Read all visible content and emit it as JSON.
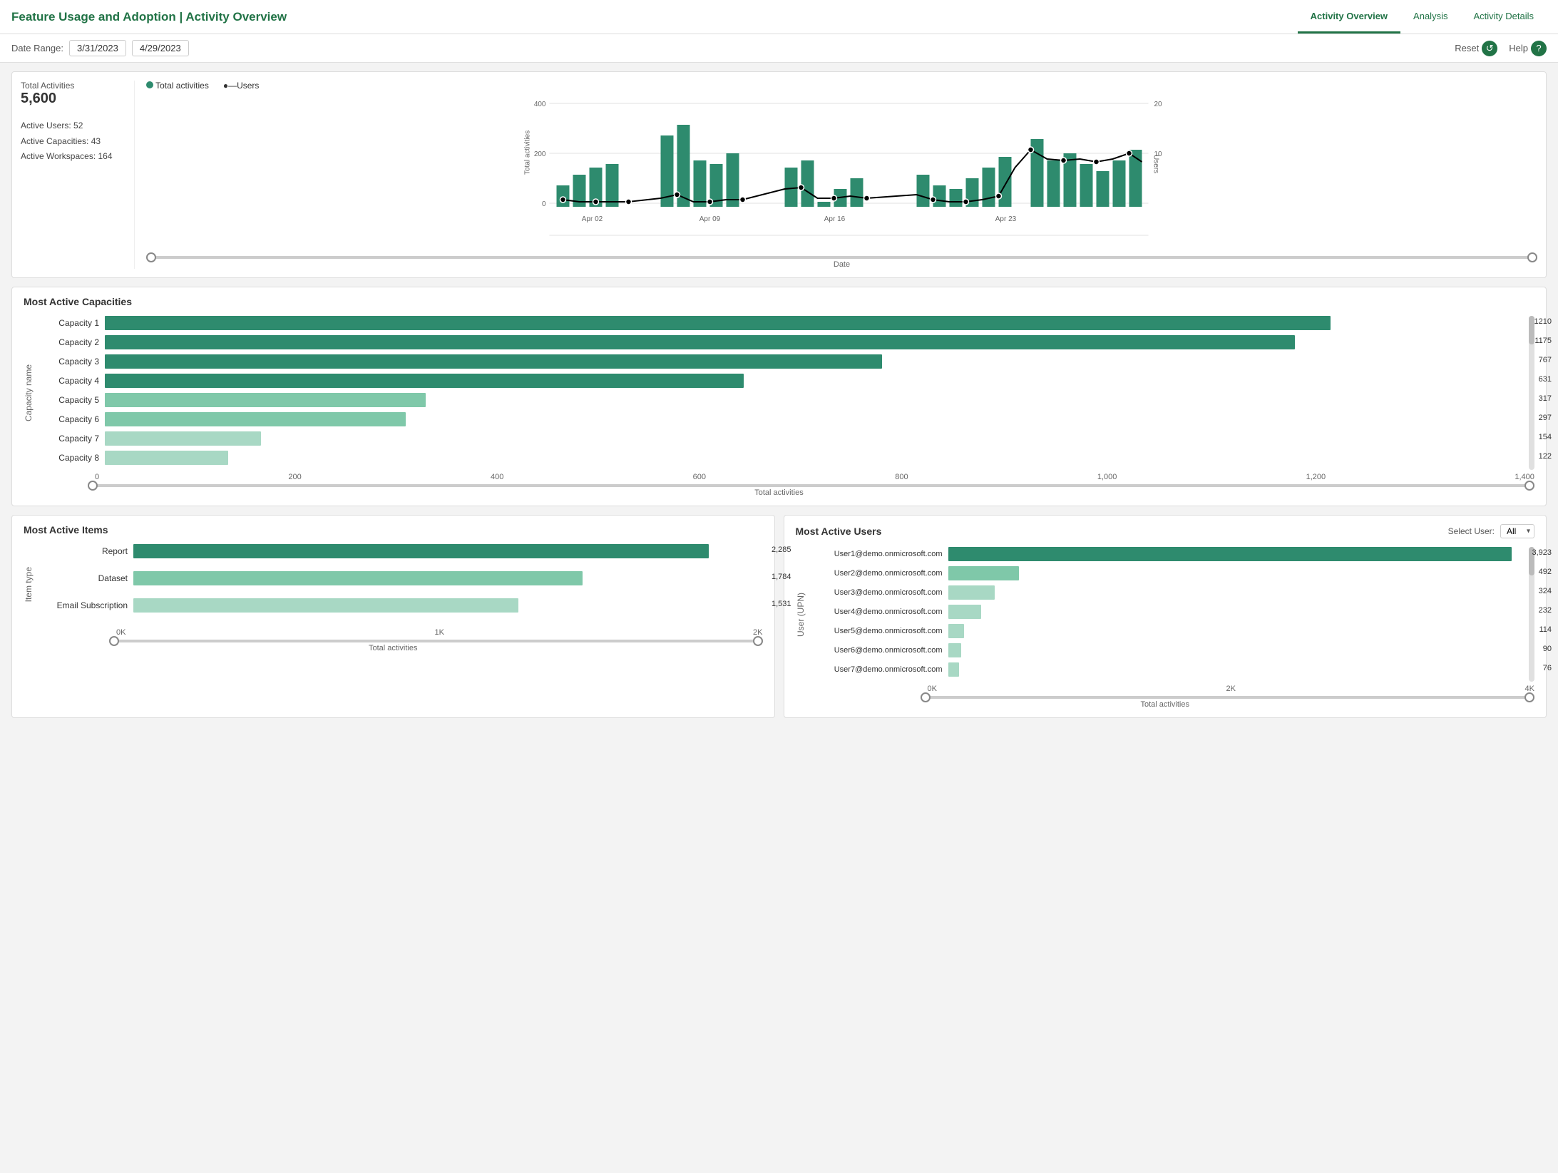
{
  "header": {
    "title": "Feature Usage and Adoption | Activity Overview",
    "nav": {
      "tabs": [
        {
          "label": "Activity Overview",
          "active": true
        },
        {
          "label": "Analysis",
          "active": false
        },
        {
          "label": "Activity Details",
          "active": false
        }
      ]
    },
    "toolbar": {
      "date_range_label": "Date Range:",
      "date_start": "3/31/2023",
      "date_end": "4/29/2023",
      "reset_label": "Reset",
      "help_label": "Help"
    }
  },
  "stats": {
    "total_activities_label": "Total Activities",
    "total_activities_value": "5,600",
    "active_users_label": "Active Users:",
    "active_users_value": "52",
    "active_capacities_label": "Active Capacities:",
    "active_capacities_value": "43",
    "active_workspaces_label": "Active Workspaces:",
    "active_workspaces_value": "164"
  },
  "timeline_chart": {
    "legend_total_label": "Total activities",
    "legend_users_label": "Users",
    "x_axis_label": "Date",
    "y_left_label": "Total activities",
    "y_right_label": "Users",
    "x_ticks": [
      "Apr 02",
      "Apr 09",
      "Apr 16",
      "Apr 23"
    ],
    "y_left_ticks": [
      "0",
      "200",
      "400"
    ],
    "y_right_ticks": [
      "10",
      "20"
    ],
    "bar_color_dark": "#2e8b6e",
    "bar_color_light": "#217346",
    "line_color": "#000000"
  },
  "capacity_chart": {
    "title": "Most Active Capacities",
    "y_axis_label": "Capacity name",
    "x_axis_label": "Total activities",
    "x_ticks": [
      "0",
      "200",
      "400",
      "600",
      "800",
      "1,000",
      "1,200",
      "1,400"
    ],
    "items": [
      {
        "name": "Capacity 1",
        "value": 1210,
        "max": 1400,
        "color": "#2e8b6e"
      },
      {
        "name": "Capacity 2",
        "value": 1175,
        "max": 1400,
        "color": "#2e8b6e"
      },
      {
        "name": "Capacity 3",
        "value": 767,
        "max": 1400,
        "color": "#2e8b6e"
      },
      {
        "name": "Capacity 4",
        "value": 631,
        "max": 1400,
        "color": "#2e8b6e"
      },
      {
        "name": "Capacity 5",
        "value": 317,
        "max": 1400,
        "color": "#7fc8a9"
      },
      {
        "name": "Capacity 6",
        "value": 297,
        "max": 1400,
        "color": "#7fc8a9"
      },
      {
        "name": "Capacity 7",
        "value": 154,
        "max": 1400,
        "color": "#a8d8c4"
      },
      {
        "name": "Capacity 8",
        "value": 122,
        "max": 1400,
        "color": "#a8d8c4"
      }
    ]
  },
  "items_chart": {
    "title": "Most Active Items",
    "y_axis_label": "Item type",
    "x_axis_label": "Total activities",
    "x_ticks": [
      "0K",
      "1K",
      "2K"
    ],
    "items": [
      {
        "name": "Report",
        "value": 2285,
        "max": 2500,
        "color": "#2e8b6e",
        "value_label": "2,285"
      },
      {
        "name": "Dataset",
        "value": 1784,
        "max": 2500,
        "color": "#7fc8a9",
        "value_label": "1,784"
      },
      {
        "name": "Email Subscription",
        "value": 1531,
        "max": 2500,
        "color": "#a8d8c4",
        "value_label": "1,531"
      }
    ]
  },
  "users_chart": {
    "title": "Most Active Users",
    "select_label": "Select User:",
    "select_value": "All",
    "y_axis_label": "User (UPN)",
    "x_axis_label": "Total activities",
    "x_ticks": [
      "0K",
      "2K",
      "4K"
    ],
    "items": [
      {
        "name": "User1@demo.onmicrosoft.com",
        "value": 3923,
        "max": 4000,
        "color": "#2e8b6e",
        "value_label": "3,923"
      },
      {
        "name": "User2@demo.onmicrosoft.com",
        "value": 492,
        "max": 4000,
        "color": "#7fc8a9",
        "value_label": "492"
      },
      {
        "name": "User3@demo.onmicrosoft.com",
        "value": 324,
        "max": 4000,
        "color": "#a8d8c4",
        "value_label": "324"
      },
      {
        "name": "User4@demo.onmicrosoft.com",
        "value": 232,
        "max": 4000,
        "color": "#a8d8c4",
        "value_label": "232"
      },
      {
        "name": "User5@demo.onmicrosoft.com",
        "value": 114,
        "max": 4000,
        "color": "#a8d8c4",
        "value_label": "114"
      },
      {
        "name": "User6@demo.onmicrosoft.com",
        "value": 90,
        "max": 4000,
        "color": "#a8d8c4",
        "value_label": "90"
      },
      {
        "name": "User7@demo.onmicrosoft.com",
        "value": 76,
        "max": 4000,
        "color": "#a8d8c4",
        "value_label": "76"
      }
    ]
  }
}
